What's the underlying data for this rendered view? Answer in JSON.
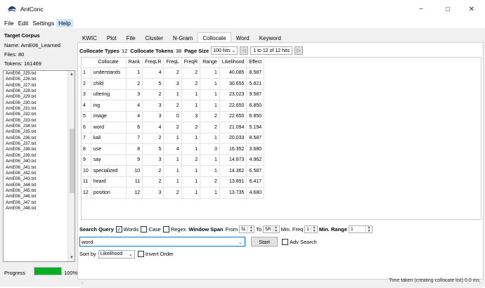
{
  "window": {
    "title": "AntConc",
    "controls": {
      "minimize": "−",
      "maximize": "□",
      "close": "✕"
    }
  },
  "menu": [
    "File",
    "Edit",
    "Settings",
    "Help"
  ],
  "corpus": {
    "heading": "Target Corpus",
    "name_label": "Name:",
    "name_value": "AmE06_Learned",
    "files_label": "Files:",
    "files_value": "80",
    "tokens_label": "Tokens:",
    "tokens_value": "161469",
    "files": [
      "AmE06_J25.txt",
      "AmE06_J26.txt",
      "AmE06_J27.txt",
      "AmE06_J28.txt",
      "AmE06_J29.txt",
      "AmE06_J30.txt",
      "AmE06_J31.txt",
      "AmE06_J32.txt",
      "AmE06_J33.txt",
      "AmE06_J34.txt",
      "AmE06_J35.txt",
      "AmE06_J36.txt",
      "AmE06_J37.txt",
      "AmE06_J38.txt",
      "AmE06_J39.txt",
      "AmE06_J40.txt",
      "AmE06_J41.txt",
      "AmE06_J42.txt",
      "AmE06_J43.txt",
      "AmE06_J44.txt",
      "AmE06_J45.txt",
      "AmE06_J46.txt",
      "AmE06_J47.txt",
      "AmE06_J48.txt"
    ]
  },
  "progress": {
    "label": "Progress",
    "value": 1.0,
    "percent_text": "100%"
  },
  "tabs": [
    "KWIC",
    "Plot",
    "File",
    "Cluster",
    "N-Gram",
    "Collocate",
    "Word",
    "Keyword"
  ],
  "active_tab": "Collocate",
  "stats": {
    "types_label": "Collocate Types",
    "types_value": "12",
    "tokens_label": "Collocate Tokens",
    "tokens_value": "38",
    "page_size_label": "Page Size",
    "page_size_value": "100 hits",
    "hits_text": "1 to 12 of 12 hits"
  },
  "table": {
    "columns": [
      "Collocate",
      "Rank",
      "FreqLR",
      "FreqL",
      "FreqR",
      "Range",
      "Likelihood",
      "Effect"
    ],
    "rows": [
      [
        "1",
        "understands",
        "1",
        "4",
        "2",
        "2",
        "1",
        "40.085",
        "8.587"
      ],
      [
        "2",
        "child",
        "2",
        "5",
        "3",
        "2",
        "1",
        "30.655",
        "5.821"
      ],
      [
        "3",
        "uttering",
        "3",
        "2",
        "1",
        "1",
        "1",
        "23.023",
        "9.587"
      ],
      [
        "4",
        "ing",
        "4",
        "3",
        "2",
        "1",
        "1",
        "22.650",
        "6.850"
      ],
      [
        "5",
        "image",
        "4",
        "3",
        "0",
        "3",
        "2",
        "22.650",
        "6.850"
      ],
      [
        "6",
        "word",
        "6",
        "4",
        "2",
        "2",
        "2",
        "21.094",
        "5.194"
      ],
      [
        "7",
        "kali",
        "7",
        "2",
        "1",
        "1",
        "1",
        "20.033",
        "8.587"
      ],
      [
        "8",
        "use",
        "8",
        "5",
        "4",
        "1",
        "3",
        "16.352",
        "3.680"
      ],
      [
        "9",
        "say",
        "9",
        "3",
        "1",
        "2",
        "1",
        "14.873",
        "4.962"
      ],
      [
        "10",
        "specialized",
        "10",
        "2",
        "1",
        "1",
        "1",
        "14.362",
        "6.587"
      ],
      [
        "11",
        "heard",
        "11",
        "2",
        "1",
        "1",
        "2",
        "13.891",
        "6.417"
      ],
      [
        "12",
        "position",
        "12",
        "3",
        "2",
        "1",
        "1",
        "13.735",
        "4.680"
      ]
    ]
  },
  "search": {
    "query_label": "Search Query",
    "words_label": "Words",
    "words_checked": "✓",
    "case_label": "Case",
    "regex_label": "Regex",
    "window_label": "Window Span",
    "from_label": "From",
    "from_value": "5L",
    "to_label": "To",
    "to_value": "5R",
    "minfreq_label": "Min. Freq",
    "minfreq_value": "1",
    "minrange_label": "Min. Range",
    "minrange_value": "1",
    "term": "word",
    "start_label": "Start",
    "adv_label": "Adv Search"
  },
  "sort": {
    "label": "Sort by",
    "value": "Likelihood",
    "invert_label": "Invert Order"
  },
  "status": {
    "text": "Time taken (creating collocate list) 0.0 ms"
  }
}
